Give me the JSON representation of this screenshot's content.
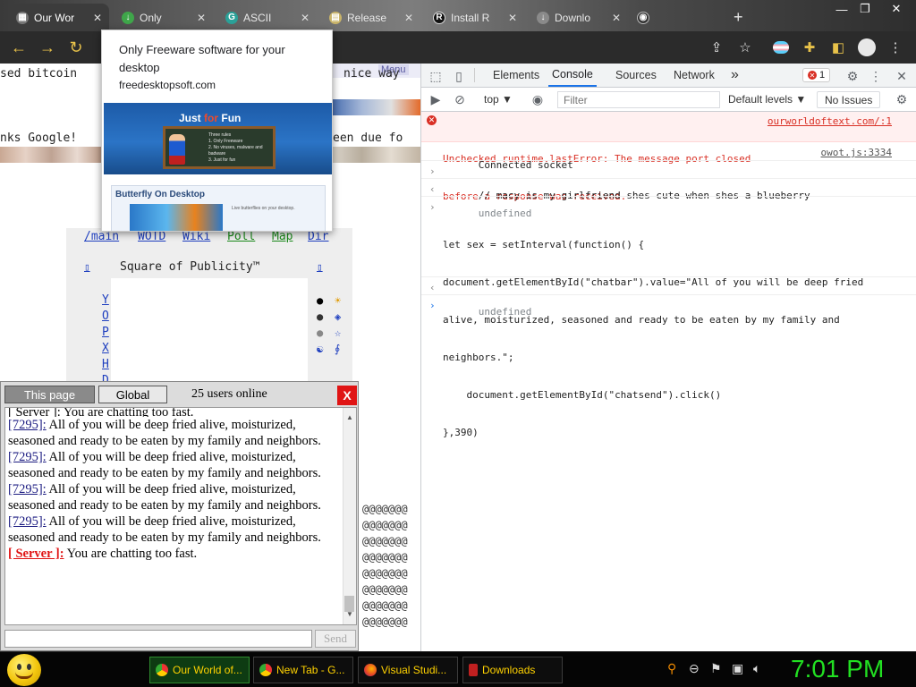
{
  "browser": {
    "tabs": [
      {
        "title": "Our Wor",
        "active": true
      },
      {
        "title": "Only",
        "active": false
      },
      {
        "title": "ASCII",
        "active": false
      },
      {
        "title": "Release",
        "active": false
      },
      {
        "title": "Install R",
        "active": false
      },
      {
        "title": "Downlo",
        "active": false
      }
    ],
    "new_tab": "+",
    "controls": {
      "minimize": "—",
      "maximize": "❐",
      "close": "✕"
    }
  },
  "toolbar": {
    "back": "←",
    "forward": "→",
    "reload": "↻"
  },
  "webpage": {
    "menu_tag": "Menu",
    "row1_left": "sed bitcoin",
    "row1_right": "nice way",
    "row2_left": "nks Google!",
    "row2_right": "een due fo",
    "nav_links": [
      "/main",
      "WOTD",
      "Wiki",
      "Poll",
      "Map",
      "Dir"
    ],
    "square_title": "Square of Publicity™",
    "box_glyph": "▯",
    "vertical_links": [
      "Y",
      "O",
      "P",
      "X",
      "H",
      "D"
    ],
    "symbols_col1": [
      "●",
      "●",
      "●",
      "☯"
    ],
    "symbols_col2": [
      "☀",
      "◈",
      "☆",
      "∮"
    ],
    "at_rows": [
      "@@@@@@@",
      "@@@@@@@",
      "@@@@@@@",
      "@@@@@@@",
      "@@@@@@@",
      "@@@@@@@",
      "@@@@@@@",
      "@@@@@@@"
    ]
  },
  "popup": {
    "title": "Only Freeware software for your desktop",
    "domain": "freedesktopsoft.com",
    "img1_header_a": "Just",
    "img1_header_b": "for",
    "img1_header_c": "Fun",
    "board_text": "Three rules\n1. Only Freeware\n2. No viruses, malware and badware\n3. Just for fun",
    "img2_header": "Butterfly On Desktop",
    "img2_body": "Live butterflies on your desktop."
  },
  "chat": {
    "tab_this_page": "This page",
    "tab_global": "Global",
    "users_online": "25 users online",
    "close": "X",
    "top_cut": "[ Server ]: You are chatting too fast.",
    "messages": [
      {
        "nick": "[7295]:",
        "text": " All of you will be deep fried alive, moisturized, seasoned and ready to be eaten by my family and neighbors."
      },
      {
        "nick": "[7295]:",
        "text": " All of you will be deep fried alive, moisturized, seasoned and ready to be eaten by my family and neighbors."
      },
      {
        "nick": "[7295]:",
        "text": " All of you will be deep fried alive, moisturized, seasoned and ready to be eaten by my family and neighbors."
      },
      {
        "nick": "[7295]:",
        "text": " All of you will be deep fried alive, moisturized, seasoned and ready to be eaten by my family and neighbors."
      }
    ],
    "server_nick": "[ Server ]:",
    "server_text": " You are chatting too fast.",
    "input_value": "",
    "send": "Send"
  },
  "devtools": {
    "tabs": [
      "Elements",
      "Console",
      "Sources",
      "Network"
    ],
    "more_tabs": "»",
    "error_count": "1",
    "context": "top ▼",
    "filter_placeholder": "Filter",
    "levels": "Default levels ▼",
    "no_issues": "No Issues",
    "console": {
      "error_line1": "Unchecked runtime.lastError: The message port closed",
      "error_line2": "before a response was received.",
      "error_src": "ourworldoftext.com/:1",
      "connected": "Connected socket",
      "connected_src": "owot.js:3334",
      "comment": "// macy is my girlfriend shes cute when shes a blueberry",
      "undefined1": "undefined",
      "code_line1": "let sex = setInterval(function() {",
      "code_line2": "document.getElementById(\"chatbar\").value=\"All of you will be deep fried",
      "code_line3": "alive, moisturized, seasoned and ready to be eaten by my family and",
      "code_line4": "neighbors.\";",
      "code_line5": "    document.getElementById(\"chatsend\").click()",
      "code_line6": "},390)",
      "undefined2": "undefined",
      "prompt": "›"
    }
  },
  "taskbar": {
    "tasks": [
      "Our World of...",
      "New Tab - G...",
      "Visual Studi...",
      "Downloads"
    ],
    "clock": "7:01 PM"
  }
}
